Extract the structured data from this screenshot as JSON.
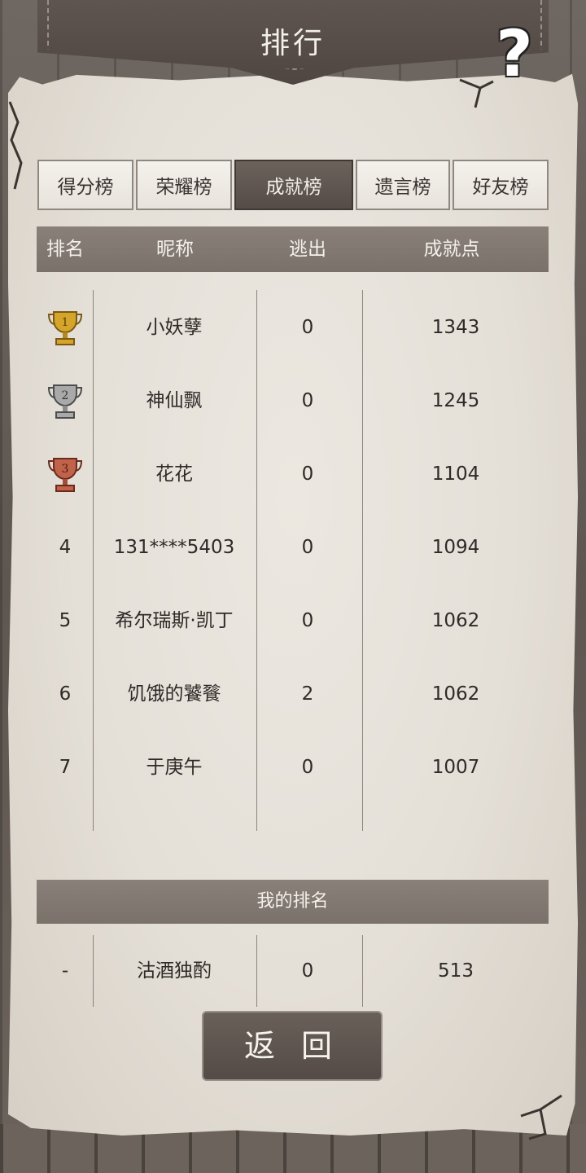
{
  "title": "排行",
  "tabs": [
    {
      "label": "得分榜",
      "active": false
    },
    {
      "label": "荣耀榜",
      "active": false
    },
    {
      "label": "成就榜",
      "active": true
    },
    {
      "label": "遗言榜",
      "active": false
    },
    {
      "label": "好友榜",
      "active": false
    }
  ],
  "columns": {
    "rank": "排名",
    "nickname": "昵称",
    "escape": "逃出",
    "points": "成就点"
  },
  "rows": [
    {
      "rank": "",
      "trophy": "gold-trophy-icon",
      "name": "小妖孽",
      "escape": "0",
      "points": "1343"
    },
    {
      "rank": "",
      "trophy": "silver-trophy-icon",
      "name": "神仙飘",
      "escape": "0",
      "points": "1245"
    },
    {
      "rank": "",
      "trophy": "bronze-trophy-icon",
      "name": "花花",
      "escape": "0",
      "points": "1104"
    },
    {
      "rank": "4",
      "name": "131****5403",
      "escape": "0",
      "points": "1094"
    },
    {
      "rank": "5",
      "name": "希尔瑞斯·凯丁",
      "escape": "0",
      "points": "1062"
    },
    {
      "rank": "6",
      "name": "饥饿的饕餮",
      "escape": "2",
      "points": "1062"
    },
    {
      "rank": "7",
      "name": "于庚午",
      "escape": "0",
      "points": "1007"
    }
  ],
  "my_rank": {
    "header": "我的排名",
    "rank": "-",
    "name": "沽酒独酌",
    "escape": "0",
    "points": "513"
  },
  "back_label": "返 回",
  "colors": {
    "accent": "#5f5550",
    "paper": "#e8e3dc",
    "gold": "#d4a52a",
    "silver": "#a9a9a9",
    "bronze": "#c0634a"
  }
}
